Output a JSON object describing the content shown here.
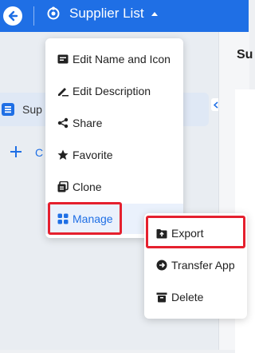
{
  "header": {
    "app_title": "Supplier List",
    "accent_color": "#1f6fe5"
  },
  "sidebar": {
    "app_item_label": "Sup",
    "create_label": "C"
  },
  "main": {
    "heading": "Su"
  },
  "menu": {
    "items": [
      {
        "label": "Edit Name and Icon",
        "icon": "edit-card-icon"
      },
      {
        "label": "Edit Description",
        "icon": "pen-icon"
      },
      {
        "label": "Share",
        "icon": "share-icon"
      },
      {
        "label": "Favorite",
        "icon": "star-icon"
      },
      {
        "label": "Clone",
        "icon": "clone-icon"
      },
      {
        "label": "Manage",
        "icon": "grid-icon",
        "active": true
      }
    ]
  },
  "submenu": {
    "items": [
      {
        "label": "Export",
        "icon": "export-icon"
      },
      {
        "label": "Transfer App",
        "icon": "transfer-icon"
      },
      {
        "label": "Delete",
        "icon": "trash-icon"
      }
    ]
  },
  "highlight_color": "#e5202e"
}
